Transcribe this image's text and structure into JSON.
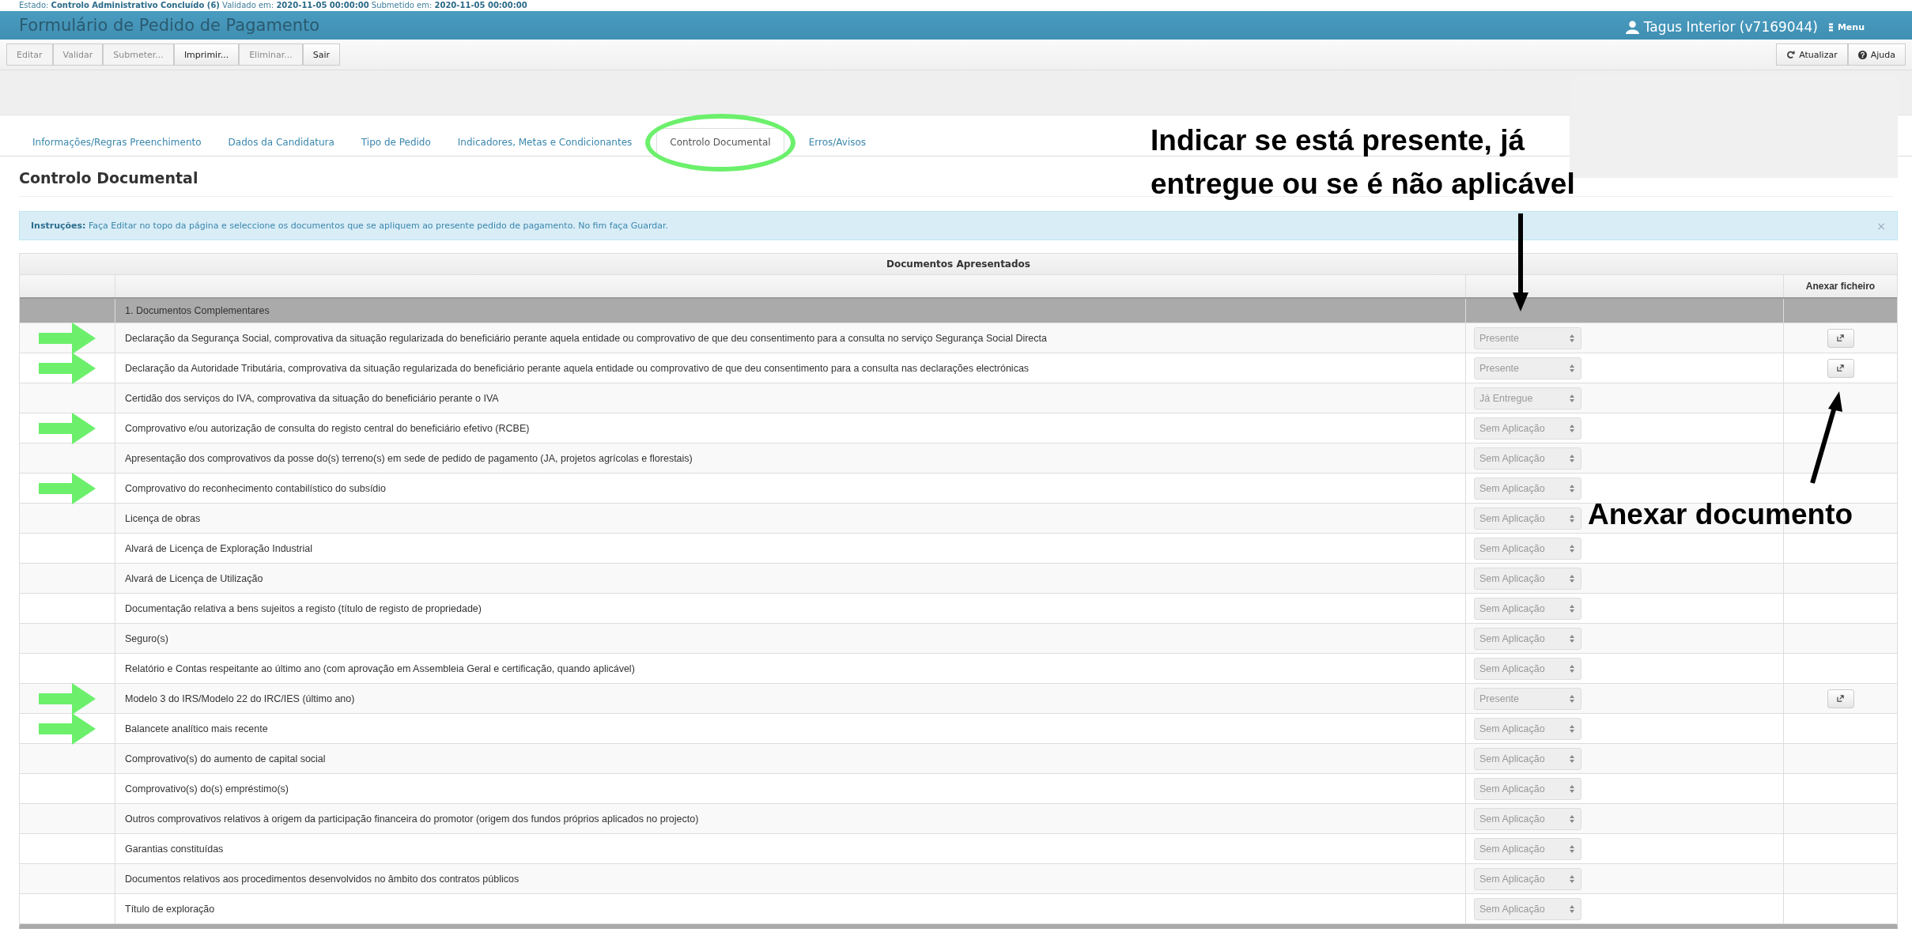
{
  "header": {
    "status_line": "Estado: **Controlo Administrativo Concluído (6)** Validado em: **2020-11-05 00:00:00** Submetido em: **2020-11-05 00:00:00**",
    "title": "Formulário de Pedido de Pagamento",
    "user": "Tagus Interior (v7169044)",
    "menu": "Menu"
  },
  "toolbar": {
    "left": [
      {
        "label": "Editar",
        "disabled": true
      },
      {
        "label": "Validar",
        "disabled": true
      },
      {
        "label": "Submeter...",
        "disabled": true
      },
      {
        "label": "Imprimir...",
        "disabled": false
      },
      {
        "label": "Eliminar...",
        "disabled": true
      },
      {
        "label": "Sair",
        "disabled": false
      }
    ],
    "right": [
      {
        "label": "Atualizar",
        "kind": "refresh"
      },
      {
        "label": "Ajuda",
        "kind": "help"
      }
    ]
  },
  "tabs": [
    {
      "label": "Informações/Regras Preenchimento",
      "selected": false,
      "circled": false
    },
    {
      "label": "Dados da Candidatura",
      "selected": false,
      "circled": false
    },
    {
      "label": "Tipo de Pedido",
      "selected": false,
      "circled": false
    },
    {
      "label": "Indicadores, Metas e Condicionantes",
      "selected": false,
      "circled": false
    },
    {
      "label": "Controlo Documental",
      "selected": true,
      "circled": true
    },
    {
      "label": "Erros/Avisos",
      "selected": false,
      "circled": false
    }
  ],
  "section_title": "Controlo Documental",
  "instructions": {
    "text": "**Instruções:** Faça Editar no topo da página e seleccione os documentos que se apliquem ao presente pedido de pagamento. No fim faça Guardar.",
    "close": "×"
  },
  "table": {
    "title": "Documentos Apresentados",
    "columns": {
      "attach": "Anexar ficheiro"
    },
    "group": "1. Documentos Complementares",
    "rows": [
      {
        "description": "Declaração da Segurança Social, comprovativa da situação regularizada do beneficiário perante aquela entidade ou comprovativo de que deu consentimento para a consulta no serviço Segurança Social Directa",
        "status": "Presente",
        "attachable": true,
        "highlighted": true
      },
      {
        "description": "Declaração da Autoridade Tributária, comprovativa da situação regularizada do beneficiário perante aquela entidade ou comprovativo de que deu consentimento para a consulta nas declarações electrónicas",
        "status": "Presente",
        "attachable": true,
        "highlighted": true
      },
      {
        "description": "Certidão dos serviços do IVA, comprovativa da situação do beneficiário perante o IVA",
        "status": "Já Entregue",
        "attachable": false,
        "highlighted": false
      },
      {
        "description": "Comprovativo e/ou autorização de consulta do registo central do beneficiário efetivo (RCBE)",
        "status": "Sem Aplicação",
        "attachable": false,
        "highlighted": true
      },
      {
        "description": "Apresentação dos comprovativos da posse do(s) terreno(s) em sede de pedido de pagamento (JA, projetos agrícolas e florestais)",
        "status": "Sem Aplicação",
        "attachable": false,
        "highlighted": false
      },
      {
        "description": "Comprovativo do reconhecimento contabilístico do subsídio",
        "status": "Sem Aplicação",
        "attachable": false,
        "highlighted": true
      },
      {
        "description": "Licença de obras",
        "status": "Sem Aplicação",
        "attachable": false,
        "highlighted": false
      },
      {
        "description": "Alvará de Licença de Exploração Industrial",
        "status": "Sem Aplicação",
        "attachable": false,
        "highlighted": false
      },
      {
        "description": "Alvará de Licença de Utilização",
        "status": "Sem Aplicação",
        "attachable": false,
        "highlighted": false
      },
      {
        "description": "Documentação relativa a bens sujeitos a registo (título de registo de propriedade)",
        "status": "Sem Aplicação",
        "attachable": false,
        "highlighted": false
      },
      {
        "description": "Seguro(s)",
        "status": "Sem Aplicação",
        "attachable": false,
        "highlighted": false
      },
      {
        "description": "Relatório e Contas respeitante ao último ano (com aprovação em Assembleia Geral e certificação, quando aplicável)",
        "status": "Sem Aplicação",
        "attachable": false,
        "highlighted": false
      },
      {
        "description": "Modelo 3 do IRS/Modelo 22 do IRC/IES (último ano)",
        "status": "Presente",
        "attachable": true,
        "highlighted": true
      },
      {
        "description": "Balancete analítico mais recente",
        "status": "Sem Aplicação",
        "attachable": false,
        "highlighted": true
      },
      {
        "description": "Comprovativo(s) do aumento de capital social",
        "status": "Sem Aplicação",
        "attachable": false,
        "highlighted": false
      },
      {
        "description": "Comprovativo(s) do(s) empréstimo(s)",
        "status": "Sem Aplicação",
        "attachable": false,
        "highlighted": false
      },
      {
        "description": "Outros comprovativos relativos à origem da participação financeira do promotor (origem dos fundos próprios aplicados no projecto)",
        "status": "Sem Aplicação",
        "attachable": false,
        "highlighted": false
      },
      {
        "description": "Garantias constituídas",
        "status": "Sem Aplicação",
        "attachable": false,
        "highlighted": false
      },
      {
        "description": "Documentos relativos aos procedimentos desenvolvidos no âmbito dos contratos públicos",
        "status": "Sem Aplicação",
        "attachable": false,
        "highlighted": false
      },
      {
        "description": "Título de exploração",
        "status": "Sem Aplicação",
        "attachable": false,
        "highlighted": false
      }
    ]
  },
  "annotations": {
    "status_note": "Indicar se está presente, já entregue ou se é não aplicável",
    "attach_note": "Anexar documento"
  }
}
